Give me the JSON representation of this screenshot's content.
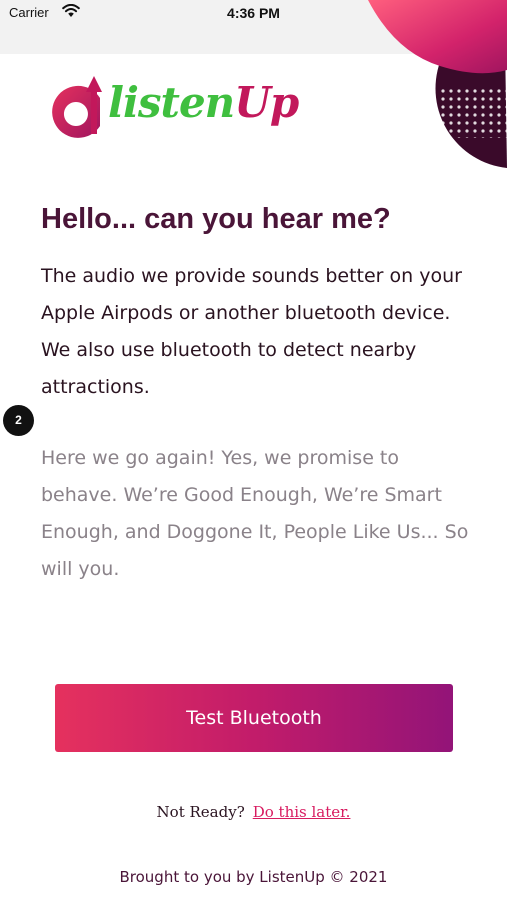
{
  "status_bar": {
    "carrier": "Carrier",
    "time": "4:36 PM"
  },
  "colors": {
    "accent_pink": "#e5315e",
    "accent_purple": "#931478",
    "heading": "#4a1538",
    "logo_green": "#3fbf3f",
    "deco_dark": "#3a0a2a"
  },
  "logo": {
    "text_main": "listen",
    "text_up": "Up"
  },
  "content": {
    "heading": "Hello... can you hear me?",
    "body": "The audio we provide sounds better on your Apple Airpods or another bluetooth device. We also use bluetooth to detect nearby attractions.",
    "step_badge": "2",
    "secondary": "Here we go again! Yes, we promise to behave. We’re Good Enough, We’re Smart Enough, and Doggone It, People Like Us... So will you."
  },
  "actions": {
    "test_button": "Test Bluetooth",
    "not_ready": "Not Ready?",
    "later_link": "Do this later."
  },
  "footer": {
    "text": "Brought to you by ListenUp © 2021"
  }
}
